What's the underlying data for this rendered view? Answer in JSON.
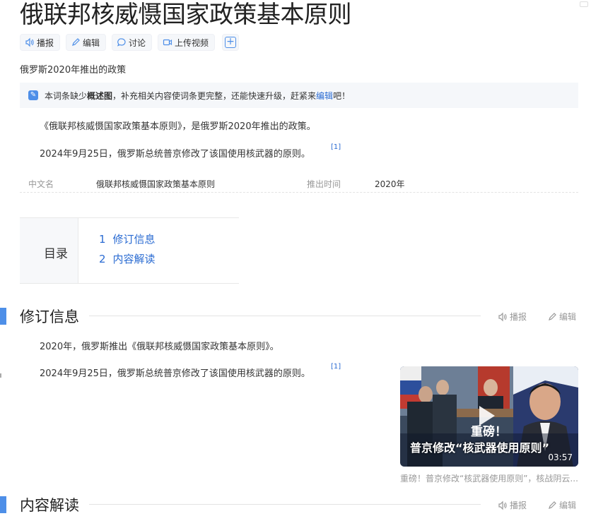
{
  "page": {
    "title": "俄联邦核威慑国家政策基本原则",
    "subtitle": "俄罗斯2020年推出的政策"
  },
  "toolbar": {
    "broadcast": "播报",
    "edit": "编辑",
    "discuss": "讨论",
    "upload_video": "上传视频",
    "add": "+"
  },
  "notice": {
    "prefix": "本词条缺少",
    "bold": "概述图",
    "middle": "，补充相关内容使词条更完整，还能快速升级，赶紧来",
    "link": "编辑",
    "suffix": "吧！"
  },
  "summary": {
    "para1": "《俄联邦核威慑国家政策基本原则》，是俄罗斯2020年推出的政策。",
    "para2": "2024年9月25日，俄罗斯总统普京修改了该国使用核武器的原则。",
    "ref": "[1]"
  },
  "infobox": {
    "k1": "中文名",
    "v1": "俄联邦核威慑国家政策基本原则",
    "k2": "推出时间",
    "v2": "2020年"
  },
  "toc": {
    "label": "目录",
    "items": [
      {
        "num": "1",
        "text": "修订信息"
      },
      {
        "num": "2",
        "text": "内容解读"
      }
    ]
  },
  "sections": [
    {
      "title": "修订信息",
      "broadcast": "播报",
      "edit": "编辑"
    },
    {
      "title": "内容解读",
      "broadcast": "播报",
      "edit": "编辑"
    }
  ],
  "revision": {
    "para1": "2020年，俄罗斯推出《俄联邦核威慑国家政策基本原则》。",
    "para2": "2024年9月25日，俄罗斯总统普京修改了该国使用核武器的原则。",
    "ref": "[1]"
  },
  "video": {
    "overlay_title": "重磅！",
    "overlay_subtitle": "普京修改“核武器使用原则”",
    "duration": "03:57",
    "caption": "重磅！普京修改“核武器使用原则”，核战阴云..."
  },
  "colors": {
    "accent": "#4e8fe8",
    "link": "#2a6bd2"
  }
}
